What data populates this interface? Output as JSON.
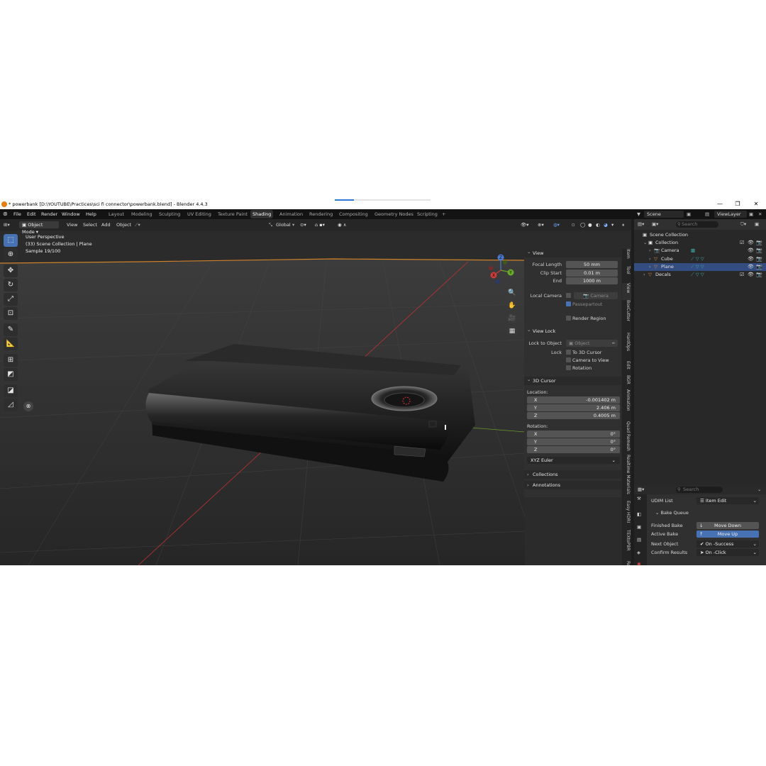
{
  "window": {
    "title": "* powerbank [D:\\YOUTUBE\\Practices\\sci fi connector\\powerbank.blend] - Blender 4.4.3",
    "controls": [
      "—",
      "❐",
      "✕"
    ]
  },
  "menu": [
    "File",
    "Edit",
    "Render",
    "Window",
    "Help"
  ],
  "workspaces": [
    {
      "label": "Layout",
      "active": false
    },
    {
      "label": "Modeling",
      "active": false
    },
    {
      "label": "Sculpting",
      "active": false
    },
    {
      "label": "UV Editing",
      "active": false
    },
    {
      "label": "Texture Paint",
      "active": false
    },
    {
      "label": "Shading",
      "active": true
    },
    {
      "label": "Animation",
      "active": false
    },
    {
      "label": "Rendering",
      "active": false
    },
    {
      "label": "Compositing",
      "active": false
    },
    {
      "label": "Geometry Nodes",
      "active": false
    },
    {
      "label": "Scripting",
      "active": false
    }
  ],
  "add_workspace": "+",
  "scene": {
    "label": "Scene",
    "view_layer": "ViewLayer"
  },
  "viewport": {
    "mode": "Object Mode",
    "menus": [
      "View",
      "Select",
      "Add",
      "Object"
    ],
    "transform": "Global",
    "info": {
      "perspective": "User Perspective",
      "collection": "(33) Scene Collection | Plane",
      "sample": "Sample 19/100"
    },
    "gizmo": {
      "x": "X",
      "y": "Y",
      "z": "Z"
    }
  },
  "npanel": {
    "view_header": "View",
    "focal_length_label": "Focal Length",
    "focal_length": "50 mm",
    "clip_start_label": "Clip Start",
    "clip_start": "0.01 m",
    "end_label": "End",
    "end": "1000 m",
    "local_camera_label": "Local Camera",
    "local_camera": "Camera",
    "passepartout": "Passepartout",
    "render_region": "Render Region",
    "view_lock_header": "View Lock",
    "lock_to_object_label": "Lock to Object",
    "lock_to_object": "Object",
    "lock_label": "Lock",
    "to_3d_cursor": "To 3D Cursor",
    "camera_to_view": "Camera to View",
    "rotation_chk": "Rotation",
    "cursor_header": "3D Cursor",
    "location_label": "Location:",
    "loc": [
      {
        "k": "X",
        "v": "-0.001402 m"
      },
      {
        "k": "Y",
        "v": "2.406 m"
      },
      {
        "k": "Z",
        "v": "0.4005 m"
      }
    ],
    "rotation_label": "Rotation:",
    "rot": [
      {
        "k": "X",
        "v": "0°"
      },
      {
        "k": "Y",
        "v": "0°"
      },
      {
        "k": "Z",
        "v": "0°"
      }
    ],
    "rotation_mode": "XYZ Euler",
    "collections_header": "Collections",
    "annotations_header": "Annotations"
  },
  "sidetabs": [
    "Item",
    "Tool",
    "View",
    "BoxCutter",
    "HardOps",
    "Edit",
    "BGR",
    "Animation",
    "Quad Remesh",
    "Realtime Materials",
    "Easy HDRI",
    "TEXtoPBR",
    "RePrim"
  ],
  "outliner": {
    "search_placeholder": "Search",
    "rows": [
      {
        "name": "Scene Collection",
        "indent": 0,
        "type": "scene"
      },
      {
        "name": "Collection",
        "indent": 1,
        "type": "collection"
      },
      {
        "name": "Camera",
        "indent": 2,
        "type": "camera"
      },
      {
        "name": "Cube",
        "indent": 2,
        "type": "mesh"
      },
      {
        "name": "Plane",
        "indent": 2,
        "type": "mesh",
        "selected": true
      },
      {
        "name": "Decals",
        "indent": 1,
        "type": "mesh"
      }
    ]
  },
  "properties": {
    "search_placeholder": "Search",
    "udim_list_label": "UDIM List",
    "udim_list_value": "Item Edit",
    "bake_queue_header": "Bake Queue",
    "finished_bake_label": "Finished Bake",
    "move_down": "Move Down",
    "active_bake_label": "Active Bake",
    "move_up": "Move Up",
    "next_object_label": "Next Object",
    "next_object_value": "On -Success",
    "confirm_results_label": "Confirm Results",
    "confirm_results_value": "On -Click"
  },
  "colors": {
    "accent": "#4772b3",
    "selection": "#334d80",
    "blender_orange": "#e87d0d"
  }
}
